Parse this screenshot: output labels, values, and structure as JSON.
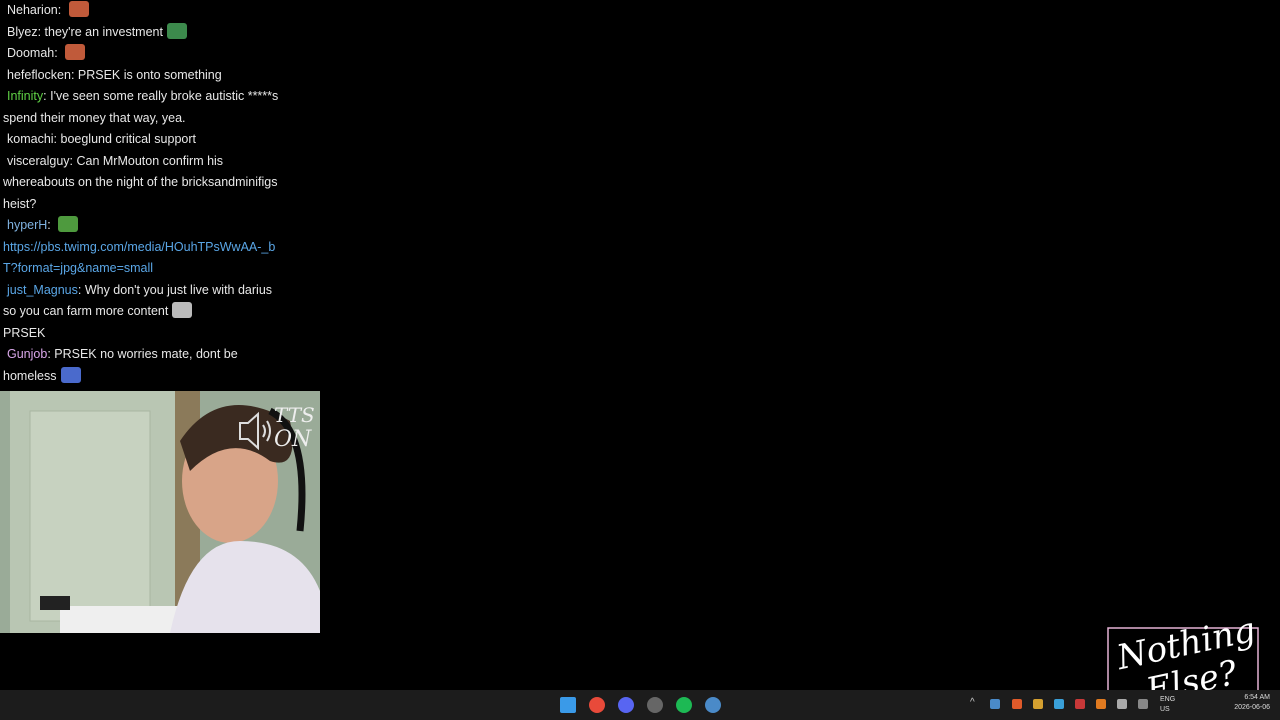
{
  "chat": [
    {
      "user": "Neharion",
      "color": "#e8e8e8",
      "sep": ": ",
      "text": "",
      "emote": "emote-cat",
      "emote_color": "#c05a3a"
    },
    {
      "user": "Blyez",
      "color": "#e8e8e8",
      "sep": ": ",
      "text": "they're an investment",
      "emote": "emote-pepe-hat",
      "emote_color": "#3c8a4c"
    },
    {
      "user": "Doomah",
      "color": "#e8e8e8",
      "sep": ": ",
      "text": "",
      "emote": "emote-cat",
      "emote_color": "#c05a3a"
    },
    {
      "user": "hefeflocken",
      "color": "#e8e8e8",
      "sep": ": ",
      "text": "PRSEK is onto something"
    },
    {
      "user": "Infinity",
      "color": "#5fd045",
      "sep": ": ",
      "text": "I've seen some really broke autistic *****s spend their money that way, yea."
    },
    {
      "user": "komachi",
      "color": "#e8e8e8",
      "sep": ": ",
      "text": "boeglund critical support"
    },
    {
      "user": "visceralguy",
      "color": "#e8e8e8",
      "sep": ": ",
      "text": "Can MrMouton confirm his whereabouts on the night of the bricksandminifigs heist?"
    },
    {
      "user": "hyperH",
      "color": "#7fb2e0",
      "sep": ": ",
      "text": "",
      "emote": "emote-pepe",
      "emote_color": "#4e9a3e",
      "link": "https://pbs.twimg.com/media/HOuhTPsWwAA-_bT?format=jpg&name=small"
    },
    {
      "user": "just_Magnus",
      "color": "#5aa6e6",
      "sep": ": ",
      "text": "Why don't you just live with darius so you can farm more content",
      "emote": "emote-bw",
      "emote_color": "#bbbbbb",
      "after": "PRSEK"
    },
    {
      "user": "Gunjob",
      "color": "#d8a6e8",
      "sep": ": ",
      "text": "PRSEK no worries mate, dont be homeless",
      "emote": "emote-wizard",
      "emote_color": "#4a6acc"
    }
  ],
  "tts": {
    "line1": "TTS",
    "line2": "ON"
  },
  "logo": {
    "line1": "Nothing",
    "line2": "Else?"
  },
  "taskbar": {
    "apps": [
      {
        "name": "windows-start-icon",
        "color": "#3a9ae8"
      },
      {
        "name": "chrome-icon",
        "color": "#e84a3a"
      },
      {
        "name": "discord-icon",
        "color": "#5865f2"
      },
      {
        "name": "obs-icon",
        "color": "#666666"
      },
      {
        "name": "spotify-icon",
        "color": "#1db954"
      },
      {
        "name": "steam-icon",
        "color": "#4a8ac8"
      }
    ],
    "clock_time": "6:54 AM",
    "clock_date": "2026-06-06",
    "lang": "ENG",
    "region": "US"
  }
}
